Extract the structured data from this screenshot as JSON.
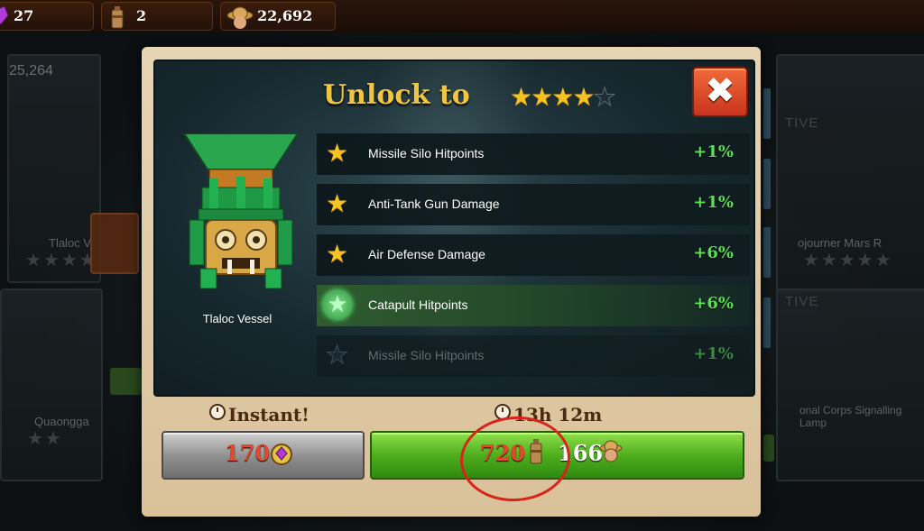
{
  "top_bar": {
    "gems": "27",
    "fuel": "2",
    "workers": "22,692"
  },
  "background": {
    "left_value": "25,264",
    "left_card_name": "Tlaloc V",
    "left_bottom_name": "Quaongga",
    "right_card_name": "ojourner Mars R",
    "right_card_name_2": "onal Corps Signalling Lamp",
    "right_tag_1": "TIVE",
    "right_tag_2": "TIVE"
  },
  "modal": {
    "title": "Unlock to",
    "target_stars": 4,
    "max_stars": 5,
    "close_label": "✖",
    "item_name": "Tlaloc Vessel",
    "bonuses": [
      {
        "label": "Missile Silo Hitpoints",
        "value": "+1%",
        "state": "unlocked"
      },
      {
        "label": "Anti-Tank Gun Damage",
        "value": "+1%",
        "state": "unlocked"
      },
      {
        "label": "Air Defense Damage",
        "value": "+6%",
        "state": "unlocked"
      },
      {
        "label": "Catapult Hitpoints",
        "value": "+6%",
        "state": "new"
      },
      {
        "label": "Missile Silo Hitpoints",
        "value": "+1%",
        "state": "locked"
      }
    ],
    "instant": {
      "label": "Instant!",
      "cost": "170"
    },
    "timed": {
      "label": "13h 12m",
      "fuel_cost": "720",
      "worker_cost": "166"
    }
  },
  "colors": {
    "gold_title": "#f0c641",
    "bonus_green": "#58e051",
    "button_green": "#4fae1d",
    "close_red": "#c8341d",
    "annotation_red": "#d8241a"
  }
}
